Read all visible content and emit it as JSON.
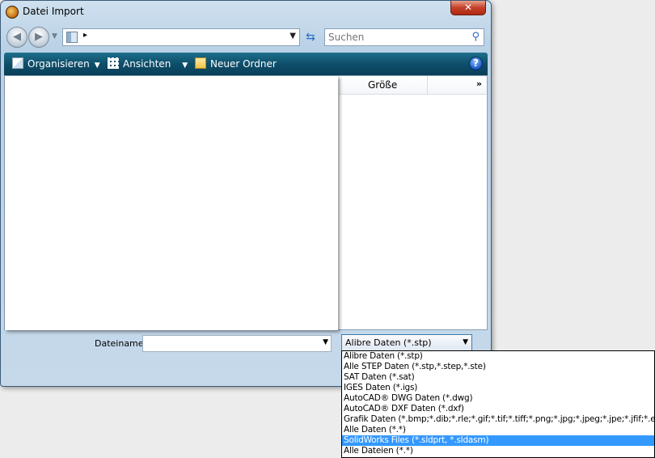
{
  "window": {
    "title": "Datei Import",
    "close_label": "✕"
  },
  "navigation": {
    "back_glyph": "◀",
    "forward_glyph": "▶",
    "address_arrow": "▸"
  },
  "search": {
    "placeholder": "Suchen"
  },
  "toolbar": {
    "organize_label": "Organisieren",
    "views_label": "Ansichten",
    "new_folder_label": "Neuer Ordner",
    "help_label": "?"
  },
  "file_list": {
    "columns": [
      "Größe"
    ],
    "more_label": "»"
  },
  "filename": {
    "label": "Dateiname:",
    "value": ""
  },
  "file_type": {
    "selected": "Alibre Daten (*.stp)",
    "options": [
      {
        "label": "Alibre Daten (*.stp)",
        "selected": false
      },
      {
        "label": "Alle STEP Daten (*.stp,*.step,*.ste)",
        "selected": false
      },
      {
        "label": "SAT Daten (*.sat)",
        "selected": false
      },
      {
        "label": "IGES Daten (*.igs)",
        "selected": false
      },
      {
        "label": "AutoCAD® DWG Daten (*.dwg)",
        "selected": false
      },
      {
        "label": "AutoCAD® DXF Daten (*.dxf)",
        "selected": false
      },
      {
        "label": "Grafik Daten (*.bmp;*.dib;*.rle;*.gif;*.tif;*.tiff;*.png;*.jpg;*.jpeg;*.jpe;*.jfif;*.emf;*.wmf)",
        "selected": false
      },
      {
        "label": "Alle Daten (*.*)",
        "selected": false
      },
      {
        "label": "SolidWorks Files (*.sldprt, *.sldasm)",
        "selected": true
      },
      {
        "label": "Alle Dateien (*.*)",
        "selected": false
      }
    ]
  },
  "colors": {
    "toolbar": "#0e4e6a",
    "selection": "#3399ff",
    "window_frame": "#c5d9ea"
  },
  "icons": [
    "app-icon",
    "close-icon",
    "back-icon",
    "forward-icon",
    "folder-icon",
    "refresh-icon",
    "search-icon",
    "organize-icon",
    "views-icon",
    "new-folder-icon",
    "help-icon"
  ]
}
